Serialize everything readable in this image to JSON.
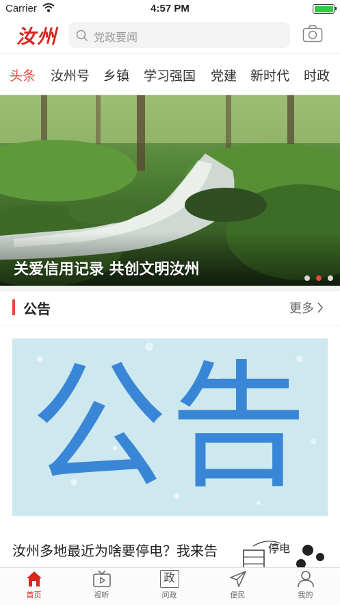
{
  "status_bar": {
    "carrier": "Carrier",
    "time": "4:57 PM",
    "battery_level": 1.0
  },
  "header": {
    "logo": "汝州",
    "search_placeholder": "党政要闻",
    "search_icon": "search-icon",
    "camera_icon": "camera-icon"
  },
  "tabs": [
    {
      "label": "头条",
      "active": true
    },
    {
      "label": "汝州号",
      "active": false
    },
    {
      "label": "乡镇",
      "active": false
    },
    {
      "label": "学习强国",
      "active": false
    },
    {
      "label": "党建",
      "active": false
    },
    {
      "label": "新时代",
      "active": false
    },
    {
      "label": "时政",
      "active": false
    }
  ],
  "banner": {
    "caption": "关爱信用记录    共创文明汝州",
    "slide_count": 3,
    "active_slide": 2
  },
  "notice": {
    "title": "公告",
    "more_label": "更多",
    "image_text": "公告"
  },
  "article": {
    "title": "汝州多地最近为啥要停电？我来告诉你答案！",
    "thumb_text": "停电"
  },
  "tabbar": [
    {
      "label": "首页",
      "icon": "home-icon",
      "active": true
    },
    {
      "label": "视听",
      "icon": "tv-icon",
      "active": false
    },
    {
      "label": "问政",
      "icon": "politics-icon",
      "glyph": "政",
      "active": false
    },
    {
      "label": "便民",
      "icon": "send-icon",
      "active": false
    },
    {
      "label": "我的",
      "icon": "user-icon",
      "active": false
    }
  ],
  "colors": {
    "accent": "#e8473b",
    "brand": "#d7261d",
    "notice_bg": "#cde8ee",
    "notice_text": "#3a86d6"
  }
}
